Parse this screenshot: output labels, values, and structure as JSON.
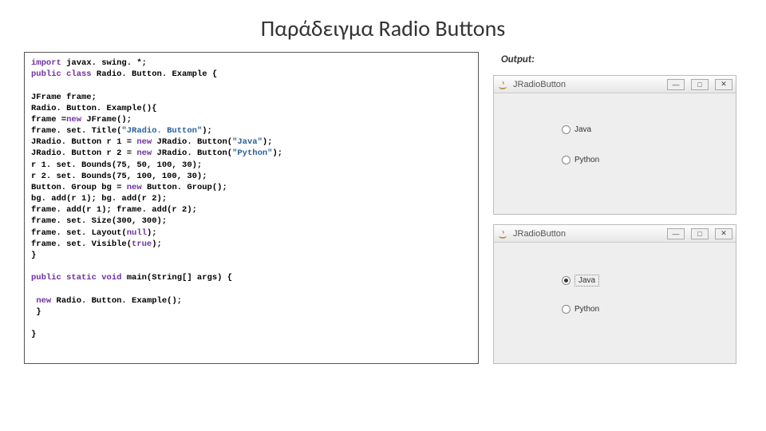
{
  "title": "Παράδειγμα Radio Buttons",
  "output_label": "Output:",
  "code": {
    "l1a": "import",
    "l1b": " javax. swing. *;",
    "l2a": "public class",
    "l2b": " Radio. Button. Example {",
    "l3": "JFrame frame;",
    "l4": "Radio. Button. Example(){",
    "l5a": "frame =",
    "l5b": "new",
    "l5c": " JFrame();",
    "l6a": "frame. set. Title(",
    "l6b": "\"JRadio. Button\"",
    "l6c": ");",
    "l7a": "JRadio. Button r 1 = ",
    "l7b": "new",
    "l7c": " JRadio. Button(",
    "l7d": "\"Java\"",
    "l7e": ");",
    "l8a": "JRadio. Button r 2 = ",
    "l8b": "new",
    "l8c": " JRadio. Button(",
    "l8d": "\"Python\"",
    "l8e": ");",
    "l9": "r 1. set. Bounds(75, 50, 100, 30);",
    "l10": "r 2. set. Bounds(75, 100, 100, 30);",
    "l11a": "Button. Group bg = ",
    "l11b": "new",
    "l11c": " Button. Group();",
    "l12": "bg. add(r 1); bg. add(r 2);",
    "l13": "frame. add(r 1); frame. add(r 2);",
    "l14": "frame. set. Size(300, 300);",
    "l15a": "frame. set. Layout(",
    "l15b": "null",
    "l15c": ");",
    "l16a": "frame. set. Visible(",
    "l16b": "true",
    "l16c": ");",
    "l17": "}",
    "l18a": "public static void",
    "l18b": " main(String[] args) {",
    "l19a": " ",
    "l19b": "new",
    "l19c": " Radio. Button. Example();",
    "l20": " }",
    "l21": "}"
  },
  "win": {
    "title": "JRadioButton",
    "opt1": "Java",
    "opt2": "Python"
  }
}
